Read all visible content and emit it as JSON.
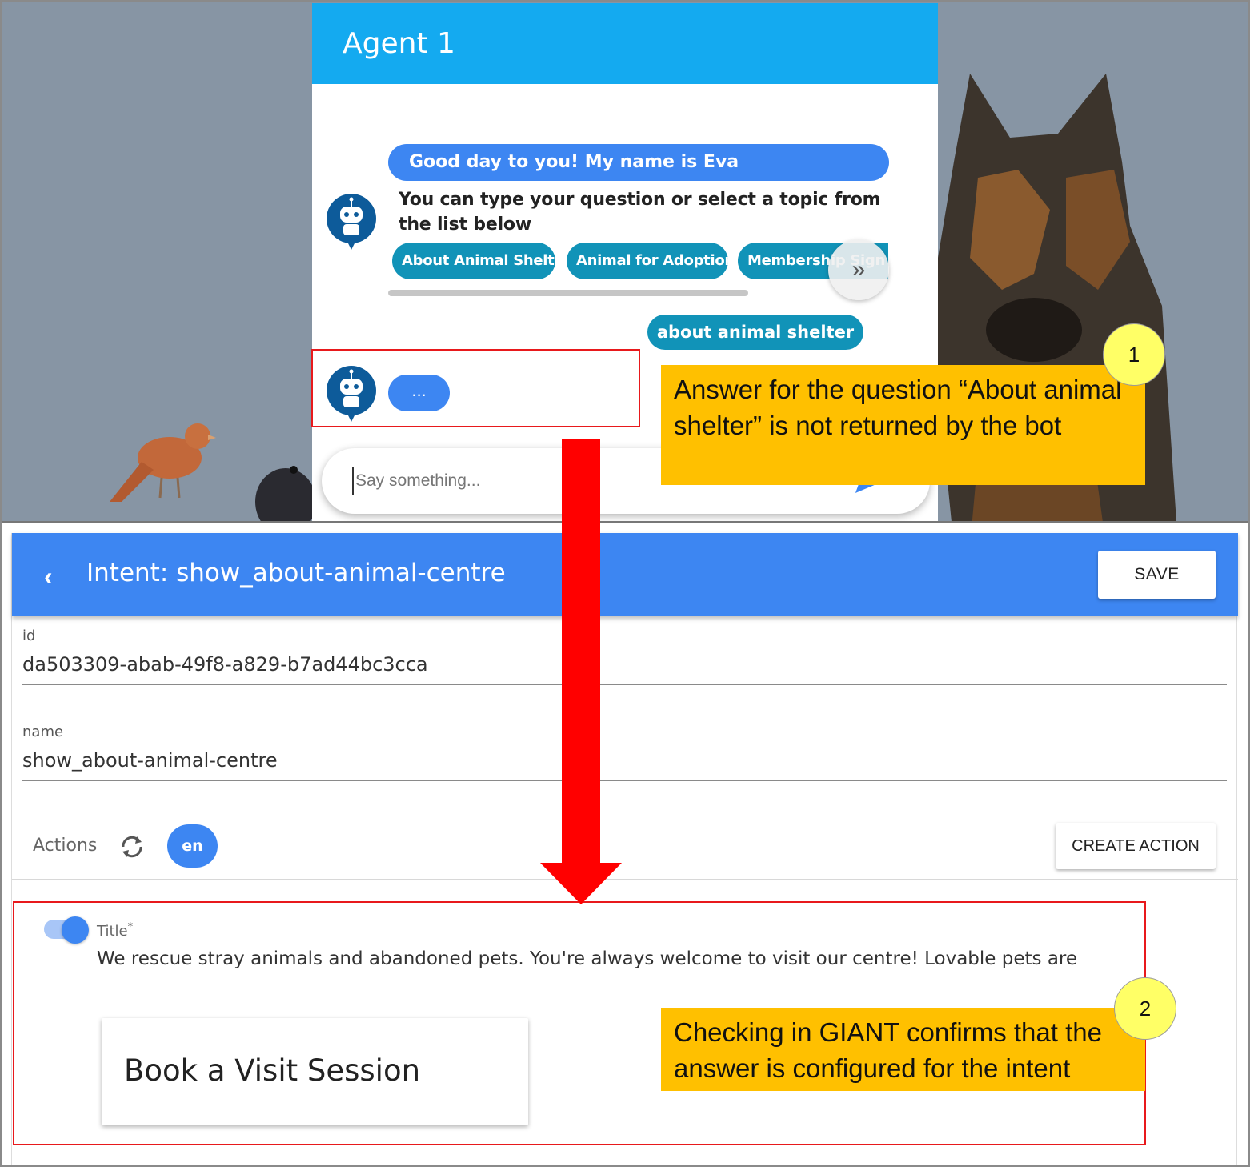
{
  "chat": {
    "header_title": "Agent 1",
    "greeting": "Good day to you! My name is Eva",
    "prompt_text": "You can type your question or select a topic from the list below",
    "chips": [
      "About Animal Shelter",
      "Animal for Adoption",
      "Membership Sign Up"
    ],
    "scroll_next_icon": "»",
    "user_message": "about animal shelter",
    "typing_indicator": "...",
    "input_placeholder": "Say something..."
  },
  "annotations": {
    "note1": {
      "number": "1",
      "text": "Answer for the question “About animal shelter” is not returned by the bot"
    },
    "note2": {
      "number": "2",
      "text": "Checking in GIANT confirms that the answer is configured for the intent"
    }
  },
  "intent": {
    "back_icon": "chevron-left",
    "title": "Intent: show_about-animal-centre",
    "save_label": "SAVE",
    "id_label": "id",
    "id_value": "da503309-abab-49f8-a829-b7ad44bc3cca",
    "name_label": "name",
    "name_value": "show_about-animal-centre",
    "actions_label": "Actions",
    "lang_label": "en",
    "create_action_label": "CREATE ACTION",
    "title_field_label": "Title",
    "title_field_required": "*",
    "title_field_value": "We rescue stray animals and abandoned pets. You're always welcome to visit our centre! Lovable pets are",
    "card_label": "Book a Visit Session"
  },
  "colors": {
    "chat_header": "#14aaf0",
    "intent_header": "#3d86f2",
    "chip": "#1193b8",
    "annotation": "#ffc000",
    "highlight_box": "#e8191c",
    "arrow": "#ff0000"
  }
}
